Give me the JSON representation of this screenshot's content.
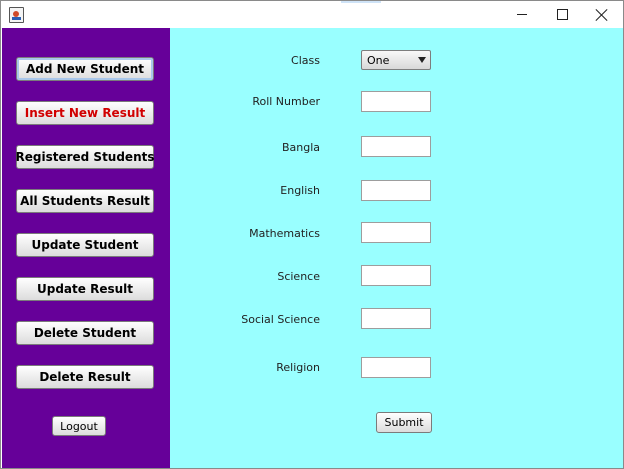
{
  "window": {
    "title": ""
  },
  "sidebar": {
    "items": [
      {
        "label": "Add New Student"
      },
      {
        "label": "Insert New Result"
      },
      {
        "label": "Registered Students"
      },
      {
        "label": "All Students Result"
      },
      {
        "label": "Update Student"
      },
      {
        "label": "Update Result"
      },
      {
        "label": "Delete Student"
      },
      {
        "label": "Delete Result"
      }
    ],
    "logout_label": "Logout"
  },
  "form": {
    "class": {
      "label": "Class",
      "selected": "One"
    },
    "fields": [
      {
        "label": "Roll Number",
        "value": ""
      },
      {
        "label": "Bangla",
        "value": ""
      },
      {
        "label": "English",
        "value": ""
      },
      {
        "label": "Mathematics",
        "value": ""
      },
      {
        "label": "Science",
        "value": ""
      },
      {
        "label": "Social Science",
        "value": ""
      },
      {
        "label": "Religion",
        "value": ""
      }
    ],
    "submit_label": "Submit"
  },
  "colors": {
    "sidebar_bg": "#660099",
    "content_bg": "#99ffff",
    "highlight_text": "#d10000"
  }
}
